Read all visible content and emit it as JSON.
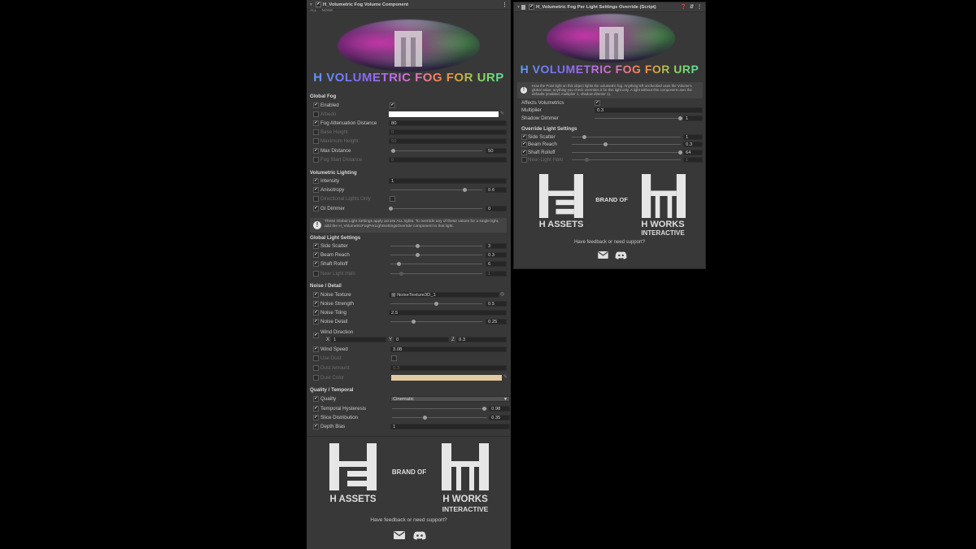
{
  "left": {
    "title": "H_Volumetric Fog Volume Component",
    "all_label": "ALL",
    "none_label": "NONE",
    "banner_title": "H VOLUMETRIC FOG FOR URP",
    "sections": {
      "global_fog": "Global Fog",
      "volumetric_lighting": "Volumetric Lighting",
      "global_light_settings": "Global Light Settings",
      "noise_detail": "Noise / Detail",
      "quality_temporal": "Quality / Temporal"
    },
    "rows": {
      "enabled": {
        "label": "Enabled"
      },
      "albedo": {
        "label": "Albedo"
      },
      "fog_atten": {
        "label": "Fog Attenuation Distance",
        "value": "80"
      },
      "base_height": {
        "label": "Base Height",
        "value": "0"
      },
      "max_height": {
        "label": "Maximum Height",
        "value": "50"
      },
      "max_distance": {
        "label": "Max Distance",
        "value": "50"
      },
      "fog_start": {
        "label": "Fog Start Distance",
        "value": "0"
      },
      "intensity": {
        "label": "Intensity",
        "value": "1"
      },
      "anisotropy": {
        "label": "Anisotropy",
        "value": "0.6"
      },
      "directional_only": {
        "label": "Directional Lights Only"
      },
      "gi_dimmer": {
        "label": "GI Dimmer",
        "value": "0"
      },
      "side_scatter": {
        "label": "Side Scatter",
        "value": "3"
      },
      "beam_reach": {
        "label": "Beam Reach",
        "value": "0.3"
      },
      "shaft_rolloff": {
        "label": "Shaft Rolloff",
        "value": "6"
      },
      "near_light_halo": {
        "label": "Near Light Halo",
        "value": "1"
      },
      "noise_texture": {
        "label": "Noise Texture",
        "value": "NoiseTexture3D_1"
      },
      "noise_strength": {
        "label": "Noise Strength",
        "value": "0.5"
      },
      "noise_tiling": {
        "label": "Noise Tiling",
        "value": "2.5"
      },
      "noise_detail": {
        "label": "Noise Detail",
        "value": "0.25"
      },
      "wind_direction": {
        "label": "Wind Direction",
        "x_label": "X",
        "x": "1",
        "y_label": "Y",
        "y": "0",
        "z_label": "Z",
        "z": "0.3"
      },
      "wind_speed": {
        "label": "Wind Speed",
        "value": "3.08"
      },
      "use_dust": {
        "label": "Use Dust"
      },
      "dust_amount": {
        "label": "Dust Amount",
        "value": "0.3"
      },
      "dust_color": {
        "label": "Dust Color"
      },
      "quality": {
        "label": "Quality",
        "value": "Cinematic"
      },
      "temporal_hysteresis": {
        "label": "Temporal Hysteresis",
        "value": "0.98"
      },
      "slice_distribution": {
        "label": "Slice Distribution",
        "value": "0.35"
      },
      "depth_bias": {
        "label": "Depth Bias",
        "value": "1"
      }
    },
    "help_text": "These Global Light Settings apply across ALL lights. To override any of these values for a single light, add the H_VolumetricFogPerLightSettingsOverride component to that light.",
    "brand": {
      "h_assets": "H ASSETS",
      "brand_of": "BRAND OF",
      "h_works": "H WORKS",
      "interactive": "INTERACTIVE"
    },
    "feedback": "Have feedback or need support?"
  },
  "right": {
    "title": "H_Volumetric Fog Per Light Settings Override (Script)",
    "banner_title": "H VOLUMETRIC FOG FOR URP",
    "help_text": "How the Point light on this object lights the volumetric fog. Anything left unchecked uses the Volume's global value; anything you check overrides it for this light only. A light without this component uses the defaults (enabled, multiplier 1, shadow dimmer 1).",
    "rows": {
      "affects": {
        "label": "Affects Volumetrics"
      },
      "multiplier": {
        "label": "Multiplier",
        "value": "0.3"
      },
      "shadow_dimmer": {
        "label": "Shadow Dimmer",
        "value": "1"
      },
      "side_scatter": {
        "label": "Side Scatter",
        "value": "1"
      },
      "beam_reach": {
        "label": "Beam Reach",
        "value": "0.3"
      },
      "shaft_rolloff": {
        "label": "Shaft Rolloff",
        "value": "64"
      },
      "near_light_halo": {
        "label": "Near-Light Halo",
        "value": "1"
      }
    },
    "section_override": "Override Light Settings",
    "brand": {
      "h_assets": "H ASSETS",
      "brand_of": "BRAND OF",
      "h_works": "H WORKS",
      "interactive": "INTERACTIVE"
    },
    "feedback": "Have feedback or need support?"
  },
  "icons": {
    "check": "✔",
    "foldout": "▼",
    "menu": "⋮",
    "warning": "!",
    "mail": "mail-icon",
    "discord": "discord-icon"
  },
  "colors": {
    "albedo": "#ffffff",
    "dust_color": "#e3c9a0",
    "panel_bg": "#383838",
    "field_bg": "#262626"
  }
}
